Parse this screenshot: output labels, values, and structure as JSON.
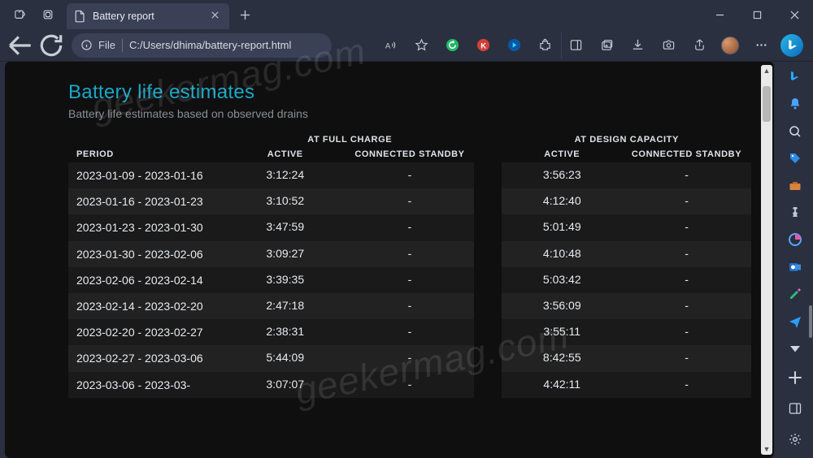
{
  "tab": {
    "title": "Battery report"
  },
  "url": {
    "scheme_label": "File",
    "path": "C:/Users/dhima/battery-report.html"
  },
  "report": {
    "heading": "Battery life estimates",
    "subtitle": "Battery life estimates based on observed drains",
    "table": {
      "group_headers": {
        "full": "AT FULL CHARGE",
        "design": "AT DESIGN CAPACITY"
      },
      "cols": {
        "period": "PERIOD",
        "active": "ACTIVE",
        "standby": "CONNECTED STANDBY"
      },
      "rows": [
        {
          "period": "2023-01-09 - 2023-01-16",
          "f_active": "3:12:24",
          "f_standby": "-",
          "d_active": "3:56:23",
          "d_standby": "-"
        },
        {
          "period": "2023-01-16 - 2023-01-23",
          "f_active": "3:10:52",
          "f_standby": "-",
          "d_active": "4:12:40",
          "d_standby": "-"
        },
        {
          "period": "2023-01-23 - 2023-01-30",
          "f_active": "3:47:59",
          "f_standby": "-",
          "d_active": "5:01:49",
          "d_standby": "-"
        },
        {
          "period": "2023-01-30 - 2023-02-06",
          "f_active": "3:09:27",
          "f_standby": "-",
          "d_active": "4:10:48",
          "d_standby": "-"
        },
        {
          "period": "2023-02-06 - 2023-02-14",
          "f_active": "3:39:35",
          "f_standby": "-",
          "d_active": "5:03:42",
          "d_standby": "-"
        },
        {
          "period": "2023-02-14 - 2023-02-20",
          "f_active": "2:47:18",
          "f_standby": "-",
          "d_active": "3:56:09",
          "d_standby": "-"
        },
        {
          "period": "2023-02-20 - 2023-02-27",
          "f_active": "2:38:31",
          "f_standby": "-",
          "d_active": "3:55:11",
          "d_standby": "-"
        },
        {
          "period": "2023-02-27 - 2023-03-06",
          "f_active": "5:44:09",
          "f_standby": "-",
          "d_active": "8:42:55",
          "d_standby": "-"
        },
        {
          "period": "2023-03-06 - 2023-03-",
          "f_active": "3:07:07",
          "f_standby": "-",
          "d_active": "4:42:11",
          "d_standby": "-"
        }
      ]
    }
  },
  "watermark": "geekermag.com"
}
